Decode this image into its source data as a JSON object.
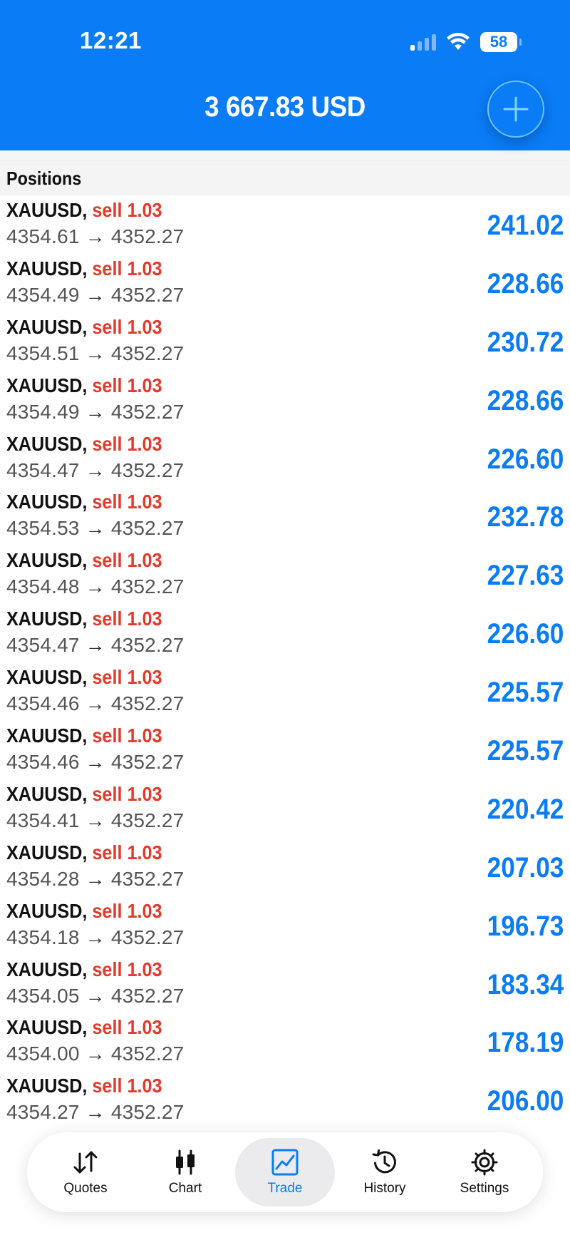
{
  "status_bar": {
    "time": "12:21",
    "battery": "58"
  },
  "header": {
    "balance": "3 667.83 USD"
  },
  "section": {
    "title": "Positions"
  },
  "positions": [
    {
      "symbol": "XAUUSD,",
      "side": "sell 1.03",
      "open": "4354.61",
      "arrow": "→",
      "current": "4352.27",
      "profit": "241.02"
    },
    {
      "symbol": "XAUUSD,",
      "side": "sell 1.03",
      "open": "4354.49",
      "arrow": "→",
      "current": "4352.27",
      "profit": "228.66"
    },
    {
      "symbol": "XAUUSD,",
      "side": "sell 1.03",
      "open": "4354.51",
      "arrow": "→",
      "current": "4352.27",
      "profit": "230.72"
    },
    {
      "symbol": "XAUUSD,",
      "side": "sell 1.03",
      "open": "4354.49",
      "arrow": "→",
      "current": "4352.27",
      "profit": "228.66"
    },
    {
      "symbol": "XAUUSD,",
      "side": "sell 1.03",
      "open": "4354.47",
      "arrow": "→",
      "current": "4352.27",
      "profit": "226.60"
    },
    {
      "symbol": "XAUUSD,",
      "side": "sell 1.03",
      "open": "4354.53",
      "arrow": "→",
      "current": "4352.27",
      "profit": "232.78"
    },
    {
      "symbol": "XAUUSD,",
      "side": "sell 1.03",
      "open": "4354.48",
      "arrow": "→",
      "current": "4352.27",
      "profit": "227.63"
    },
    {
      "symbol": "XAUUSD,",
      "side": "sell 1.03",
      "open": "4354.47",
      "arrow": "→",
      "current": "4352.27",
      "profit": "226.60"
    },
    {
      "symbol": "XAUUSD,",
      "side": "sell 1.03",
      "open": "4354.46",
      "arrow": "→",
      "current": "4352.27",
      "profit": "225.57"
    },
    {
      "symbol": "XAUUSD,",
      "side": "sell 1.03",
      "open": "4354.46",
      "arrow": "→",
      "current": "4352.27",
      "profit": "225.57"
    },
    {
      "symbol": "XAUUSD,",
      "side": "sell 1.03",
      "open": "4354.41",
      "arrow": "→",
      "current": "4352.27",
      "profit": "220.42"
    },
    {
      "symbol": "XAUUSD,",
      "side": "sell 1.03",
      "open": "4354.28",
      "arrow": "→",
      "current": "4352.27",
      "profit": "207.03"
    },
    {
      "symbol": "XAUUSD,",
      "side": "sell 1.03",
      "open": "4354.18",
      "arrow": "→",
      "current": "4352.27",
      "profit": "196.73"
    },
    {
      "symbol": "XAUUSD,",
      "side": "sell 1.03",
      "open": "4354.05",
      "arrow": "→",
      "current": "4352.27",
      "profit": "183.34"
    },
    {
      "symbol": "XAUUSD,",
      "side": "sell 1.03",
      "open": "4354.00",
      "arrow": "→",
      "current": "4352.27",
      "profit": "178.19"
    },
    {
      "symbol": "XAUUSD,",
      "side": "sell 1.03",
      "open": "4354.27",
      "arrow": "→",
      "current": "4352.27",
      "profit": "206.00"
    }
  ],
  "tabs": [
    {
      "label": "Quotes",
      "icon": "quotes-arrows-icon"
    },
    {
      "label": "Chart",
      "icon": "candlestick-icon"
    },
    {
      "label": "Trade",
      "icon": "trade-chart-icon",
      "active": true
    },
    {
      "label": "History",
      "icon": "history-clock-icon"
    },
    {
      "label": "Settings",
      "icon": "gear-icon"
    }
  ],
  "colors": {
    "accent": "#0a7cf6",
    "sell": "#e5392c"
  }
}
